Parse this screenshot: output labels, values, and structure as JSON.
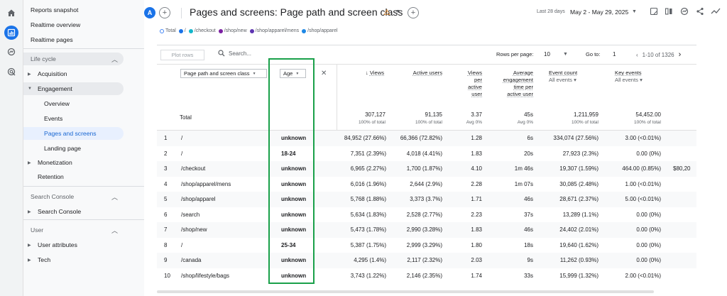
{
  "sidebar": {
    "top_items": [
      "Reports snapshot",
      "Realtime overview",
      "Realtime pages"
    ],
    "lifecycle_title": "Life cycle",
    "acquisition": "Acquisition",
    "engagement": "Engagement",
    "engagement_children": [
      "Overview",
      "Events",
      "Pages and screens",
      "Landing page"
    ],
    "monetization": "Monetization",
    "retention": "Retention",
    "search_console_title": "Search Console",
    "search_console_item": "Search Console",
    "user_title": "User",
    "user_attributes": "User attributes",
    "tech": "Tech"
  },
  "header": {
    "avatar": "A",
    "title": "Pages and screens: Page path and screen class",
    "date_label": "Last 28 days",
    "date_range": "May 2 - May 29, 2025"
  },
  "legend": [
    "Total",
    "/",
    "/checkout",
    "/shop/new",
    "/shop/apparel/mens",
    "/shop/apparel"
  ],
  "legend_colors": [
    "#4285f4",
    "#1a73e8",
    "#12b5cb",
    "#7b1fa2",
    "#5e35b1",
    "#1e88e5"
  ],
  "controls": {
    "plot_rows": "Plot rows",
    "search_placeholder": "Search...",
    "rows_per_page_label": "Rows per page:",
    "rows_per_page": "10",
    "goto_label": "Go to:",
    "goto_value": "1",
    "page_range": "1-10 of 1326"
  },
  "table": {
    "dim1": "Page path and screen class",
    "dim2": "Age",
    "metrics": {
      "views": "Views",
      "active_users": "Active users",
      "views_per_user": [
        "Views",
        "per",
        "active",
        "user"
      ],
      "avg_engagement": [
        "Average",
        "engagement",
        "time per",
        "active user"
      ],
      "event_count": "Event count",
      "event_count_sub": "All events",
      "key_events": "Key events",
      "key_events_sub": "All events"
    },
    "total_label": "Total",
    "totals": {
      "views": "307,127",
      "views_s": "100% of total",
      "active_users": "91,135",
      "active_users_s": "100% of total",
      "vpu": "3.37",
      "vpu_s": "Avg 0%",
      "avg": "45s",
      "avg_s": "Avg 0%",
      "events": "1,211,959",
      "events_s": "100% of total",
      "key": "54,452.00",
      "key_s": "100% of total"
    },
    "rows": [
      {
        "n": "1",
        "path": "/",
        "age": "unknown",
        "views": "84,952 (27.66%)",
        "users": "66,366 (72.82%)",
        "vpu": "1.28",
        "avg": "6s",
        "events": "334,074 (27.56%)",
        "key": "3.00 (<0.01%)",
        "extra": ""
      },
      {
        "n": "2",
        "path": "/",
        "age": "18-24",
        "views": "7,351 (2.39%)",
        "users": "4,018 (4.41%)",
        "vpu": "1.83",
        "avg": "20s",
        "events": "27,923 (2.3%)",
        "key": "0.00 (0%)",
        "extra": ""
      },
      {
        "n": "3",
        "path": "/checkout",
        "age": "unknown",
        "views": "6,965 (2.27%)",
        "users": "1,700 (1.87%)",
        "vpu": "4.10",
        "avg": "1m 46s",
        "events": "19,307 (1.59%)",
        "key": "464.00 (0.85%)",
        "extra": "$80,20"
      },
      {
        "n": "4",
        "path": "/shop/apparel/mens",
        "age": "unknown",
        "views": "6,016 (1.96%)",
        "users": "2,644 (2.9%)",
        "vpu": "2.28",
        "avg": "1m 07s",
        "events": "30,085 (2.48%)",
        "key": "1.00 (<0.01%)",
        "extra": ""
      },
      {
        "n": "5",
        "path": "/shop/apparel",
        "age": "unknown",
        "views": "5,768 (1.88%)",
        "users": "3,373 (3.7%)",
        "vpu": "1.71",
        "avg": "46s",
        "events": "28,671 (2.37%)",
        "key": "5.00 (<0.01%)",
        "extra": ""
      },
      {
        "n": "6",
        "path": "/search",
        "age": "unknown",
        "views": "5,634 (1.83%)",
        "users": "2,528 (2.77%)",
        "vpu": "2.23",
        "avg": "37s",
        "events": "13,289 (1.1%)",
        "key": "0.00 (0%)",
        "extra": ""
      },
      {
        "n": "7",
        "path": "/shop/new",
        "age": "unknown",
        "views": "5,473 (1.78%)",
        "users": "2,990 (3.28%)",
        "vpu": "1.83",
        "avg": "46s",
        "events": "24,402 (2.01%)",
        "key": "0.00 (0%)",
        "extra": ""
      },
      {
        "n": "8",
        "path": "/",
        "age": "25-34",
        "views": "5,387 (1.75%)",
        "users": "2,999 (3.29%)",
        "vpu": "1.80",
        "avg": "18s",
        "events": "19,640 (1.62%)",
        "key": "0.00 (0%)",
        "extra": ""
      },
      {
        "n": "9",
        "path": "/canada",
        "age": "unknown",
        "views": "4,295 (1.4%)",
        "users": "2,117 (2.32%)",
        "vpu": "2.03",
        "avg": "9s",
        "events": "11,262 (0.93%)",
        "key": "0.00 (0%)",
        "extra": ""
      },
      {
        "n": "10",
        "path": "/shop/lifestyle/bags",
        "age": "unknown",
        "views": "3,743 (1.22%)",
        "users": "2,146 (2.35%)",
        "vpu": "1.74",
        "avg": "33s",
        "events": "15,999 (1.32%)",
        "key": "2.00 (<0.01%)",
        "extra": ""
      }
    ]
  }
}
